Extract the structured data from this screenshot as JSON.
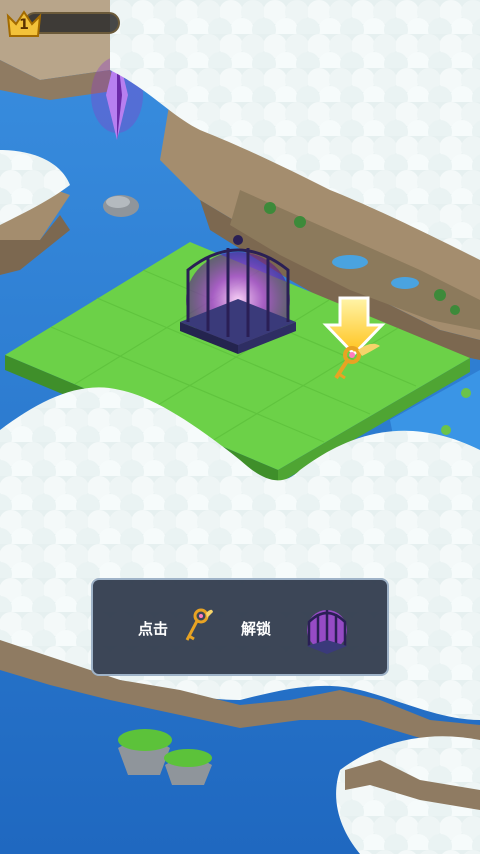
{
  "hud": {
    "level": "1",
    "progress": 0.0
  },
  "tutorial": {
    "click_label": "点击",
    "unlock_label": "解锁",
    "key_icon": "winged-key-icon",
    "cage_icon": "magic-cage-icon"
  },
  "scene_objects": {
    "cage": "magic-cage",
    "key": "winged-key",
    "arrow": "down-arrow-hint",
    "crystal": "purple-crystal"
  },
  "colors": {
    "water": "#2a7fd4",
    "grass": "#5fc63c",
    "cloud": "#e8f2f2",
    "tip_bg": "#343e50",
    "arrow": "#ffd54a"
  }
}
